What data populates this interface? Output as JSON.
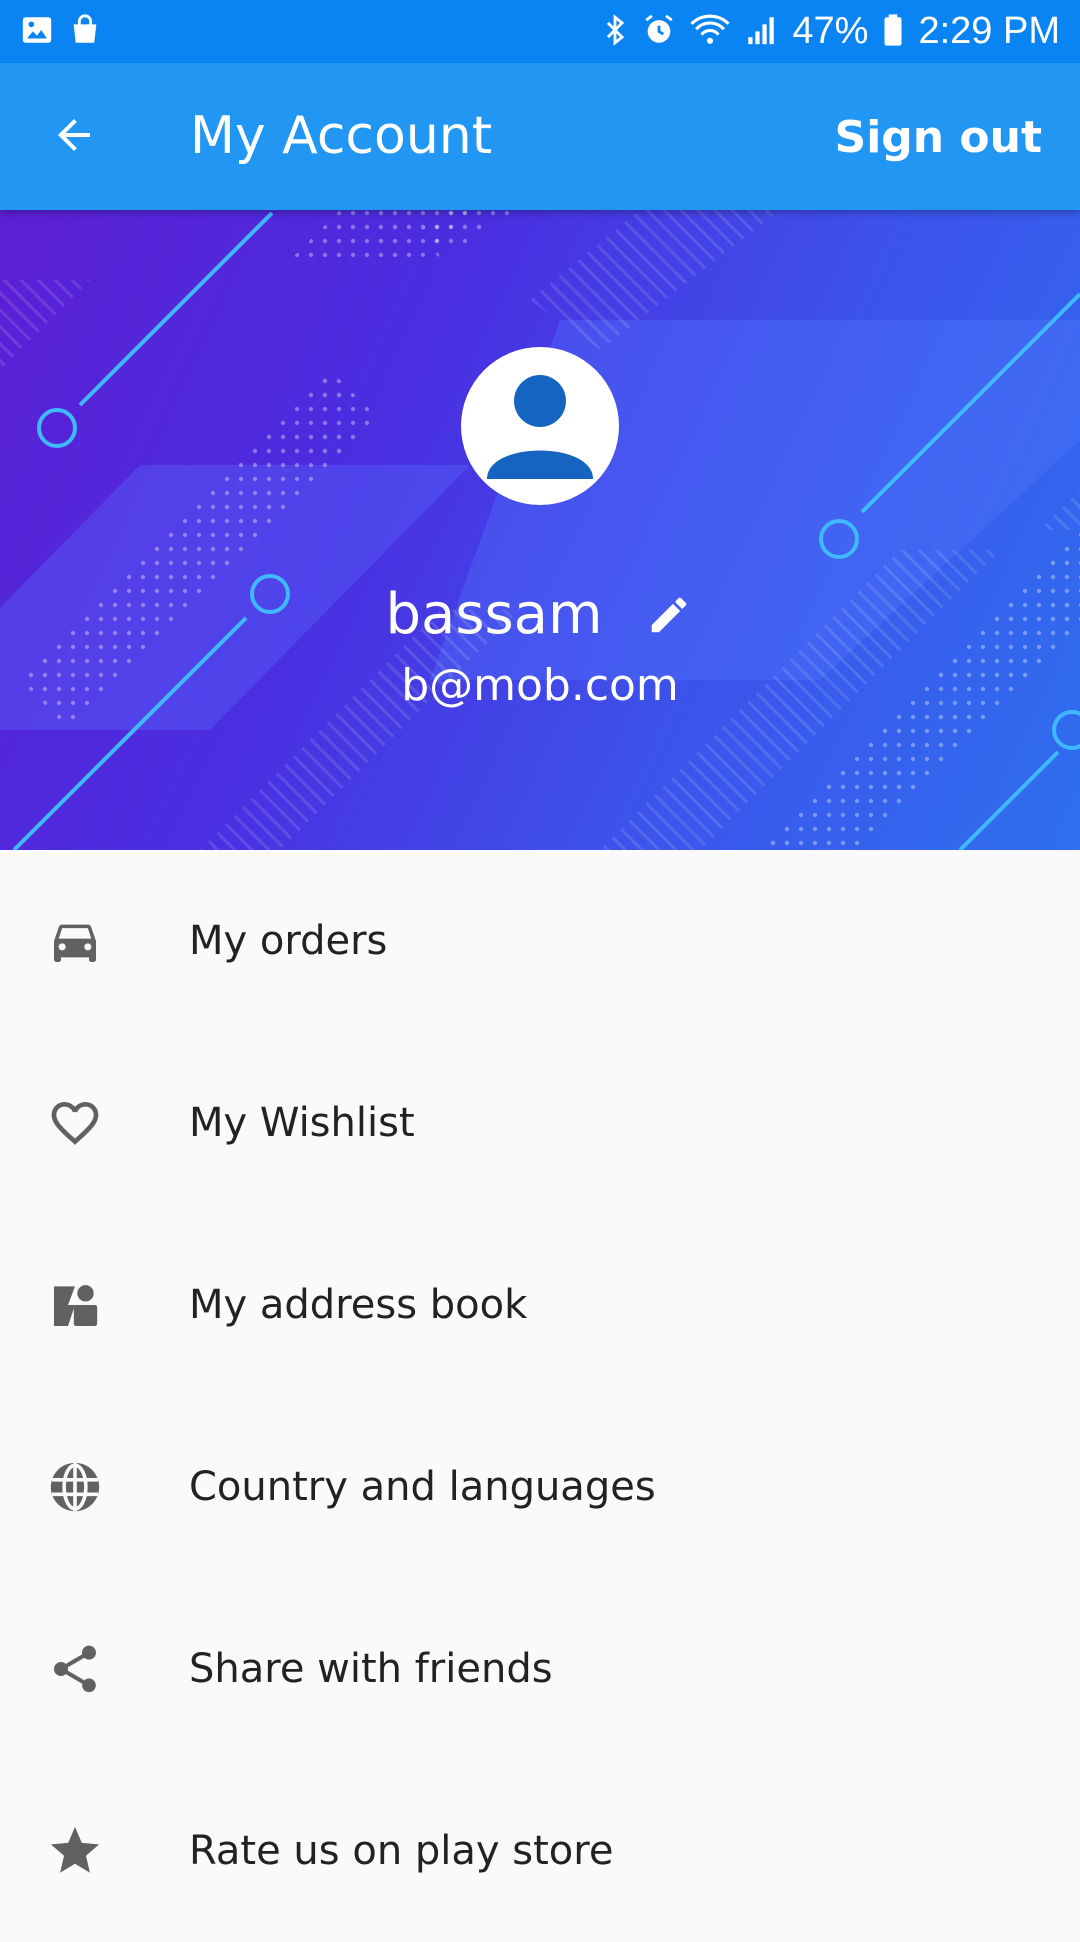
{
  "status_bar": {
    "battery": "47%",
    "time": "2:29 PM",
    "icons_left": [
      "image-icon",
      "shopping-bag-icon"
    ],
    "icons_right": [
      "bluetooth-icon",
      "alarm-icon",
      "wifi-icon",
      "signal-icon",
      "battery-icon"
    ]
  },
  "app_bar": {
    "title": "My Account",
    "sign_out_label": "Sign out"
  },
  "profile": {
    "name": "bassam",
    "email": "b@mob.com"
  },
  "menu": {
    "items": [
      {
        "label": "My orders",
        "icon": "car-icon"
      },
      {
        "label": "My Wishlist",
        "icon": "heart-icon"
      },
      {
        "label": "My address book",
        "icon": "address-book-icon"
      },
      {
        "label": "Country and languages",
        "icon": "globe-icon"
      },
      {
        "label": "Share with friends",
        "icon": "share-icon"
      },
      {
        "label": "Rate us on play store",
        "icon": "star-icon"
      }
    ]
  },
  "colors": {
    "status_bar": "#0a84f2",
    "app_bar": "#2196f3",
    "hero_start": "#5c1fd4",
    "hero_end": "#2e6ff0",
    "avatar_icon": "#1565c0",
    "menu_icon": "#616161",
    "menu_text": "#222222",
    "background": "#fafafa"
  }
}
